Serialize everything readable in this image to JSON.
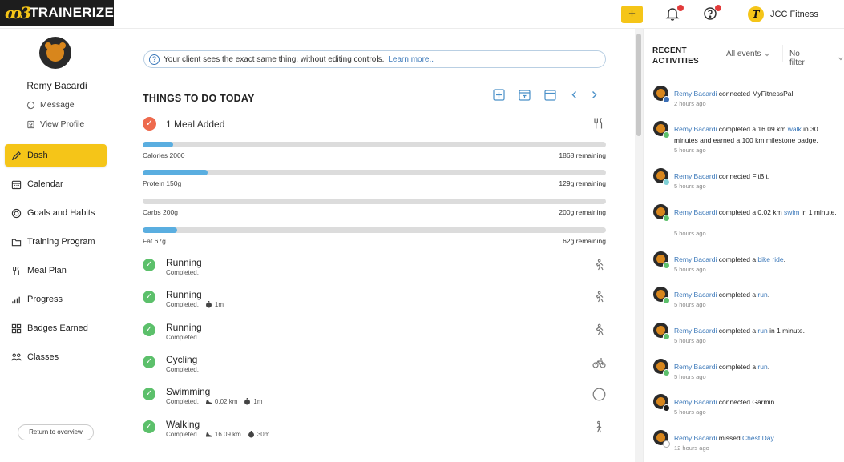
{
  "topbar": {
    "logo_mark": "ꝏ3",
    "logo_text": "TRAINERIZE",
    "add_label": "+",
    "gym_initial": "T",
    "gym_name": "JCC Fitness"
  },
  "client": {
    "name": "Remy Bacardi",
    "links": [
      {
        "label": "Message",
        "icon": "message-icon"
      },
      {
        "label": "View Profile",
        "icon": "profile-icon"
      }
    ]
  },
  "nav": [
    {
      "label": "Dash",
      "icon": "dash-icon",
      "active": true
    },
    {
      "label": "Calendar",
      "icon": "calendar-icon"
    },
    {
      "label": "Goals and Habits",
      "icon": "goals-icon"
    },
    {
      "label": "Training Program",
      "icon": "folder-icon"
    },
    {
      "label": "Meal Plan",
      "icon": "utensils-icon"
    },
    {
      "label": "Progress",
      "icon": "progress-icon"
    },
    {
      "label": "Badges Earned",
      "icon": "badges-icon"
    },
    {
      "label": "Classes",
      "icon": "classes-icon"
    }
  ],
  "return_label": "Return to overview",
  "info": {
    "text": "Your client sees the exact same thing, without editing controls.",
    "link": "Learn more.."
  },
  "todo": {
    "title": "THINGS TO DO TODAY",
    "meal_label": "1 Meal Added",
    "macros": [
      {
        "label": "Calories 2000",
        "remaining": "1868 remaining",
        "fraction": 0.066
      },
      {
        "label": "Protein 150g",
        "remaining": "129g remaining",
        "fraction": 0.14
      },
      {
        "label": "Carbs 200g",
        "remaining": "200g remaining",
        "fraction": 0.0
      },
      {
        "label": "Fat 67g",
        "remaining": "62g remaining",
        "fraction": 0.075
      }
    ],
    "activities": [
      {
        "title": "Running",
        "status": "Completed.",
        "distance": "",
        "duration": "",
        "icon": "running-icon"
      },
      {
        "title": "Running",
        "status": "Completed.",
        "distance": "",
        "duration": "1m",
        "icon": "running-icon"
      },
      {
        "title": "Running",
        "status": "Completed.",
        "distance": "",
        "duration": "",
        "icon": "running-icon"
      },
      {
        "title": "Cycling",
        "status": "Completed.",
        "distance": "",
        "duration": "",
        "icon": "cycling-icon"
      },
      {
        "title": "Swimming",
        "status": "Completed.",
        "distance": "0.02 km",
        "duration": "1m",
        "icon": "circle-icon"
      },
      {
        "title": "Walking",
        "status": "Completed.",
        "distance": "16.09 km",
        "duration": "30m",
        "icon": "walking-icon"
      }
    ]
  },
  "recent": {
    "title_line1": "RECENT",
    "title_line2": "ACTIVITIES",
    "filter_events": "All events",
    "filter_other": "No filter",
    "items": [
      {
        "name": "Remy Bacardi",
        "text": " connected MyFitnessPal.",
        "link": "",
        "tail": "",
        "time": "2 hours ago",
        "badge": "#3b6fb6"
      },
      {
        "name": "Remy Bacardi",
        "text": " completed a 16.09 km ",
        "link": "walk",
        "tail": " in 30 minutes and earned a 100 km milestone badge.",
        "time": "5 hours ago",
        "badge": "#5cc06b"
      },
      {
        "name": "Remy Bacardi",
        "text": " connected FitBit.",
        "link": "",
        "tail": "",
        "time": "5 hours ago",
        "badge": "#7fd0d6"
      },
      {
        "name": "Remy Bacardi",
        "text": " completed a 0.02 km ",
        "link": "swim",
        "tail": " in 1 minute.",
        "time": "5 hours ago",
        "badge": "#5cc06b"
      },
      {
        "name": "Remy Bacardi",
        "text": " completed a ",
        "link": "bike ride",
        "tail": ".",
        "time": "5 hours ago",
        "badge": "#5cc06b"
      },
      {
        "name": "Remy Bacardi",
        "text": " completed a ",
        "link": "run",
        "tail": ".",
        "time": "5 hours ago",
        "badge": "#5cc06b"
      },
      {
        "name": "Remy Bacardi",
        "text": " completed a ",
        "link": "run",
        "tail": " in 1 minute.",
        "time": "5 hours ago",
        "badge": "#5cc06b"
      },
      {
        "name": "Remy Bacardi",
        "text": " completed a ",
        "link": "run",
        "tail": ".",
        "time": "5 hours ago",
        "badge": "#5cc06b"
      },
      {
        "name": "Remy Bacardi",
        "text": " connected Garmin.",
        "link": "",
        "tail": "",
        "time": "5 hours ago",
        "badge": "#1a1a1a"
      },
      {
        "name": "Remy Bacardi",
        "text": " missed ",
        "link": "Chest Day",
        "tail": ".",
        "time": "12 hours ago",
        "badge": "#ffffff"
      }
    ]
  },
  "colors": {
    "accent": "#f5c518",
    "link": "#3b78b9",
    "success": "#5cc06b",
    "meal": "#ee6a4d",
    "bar": "#5aaee0"
  }
}
